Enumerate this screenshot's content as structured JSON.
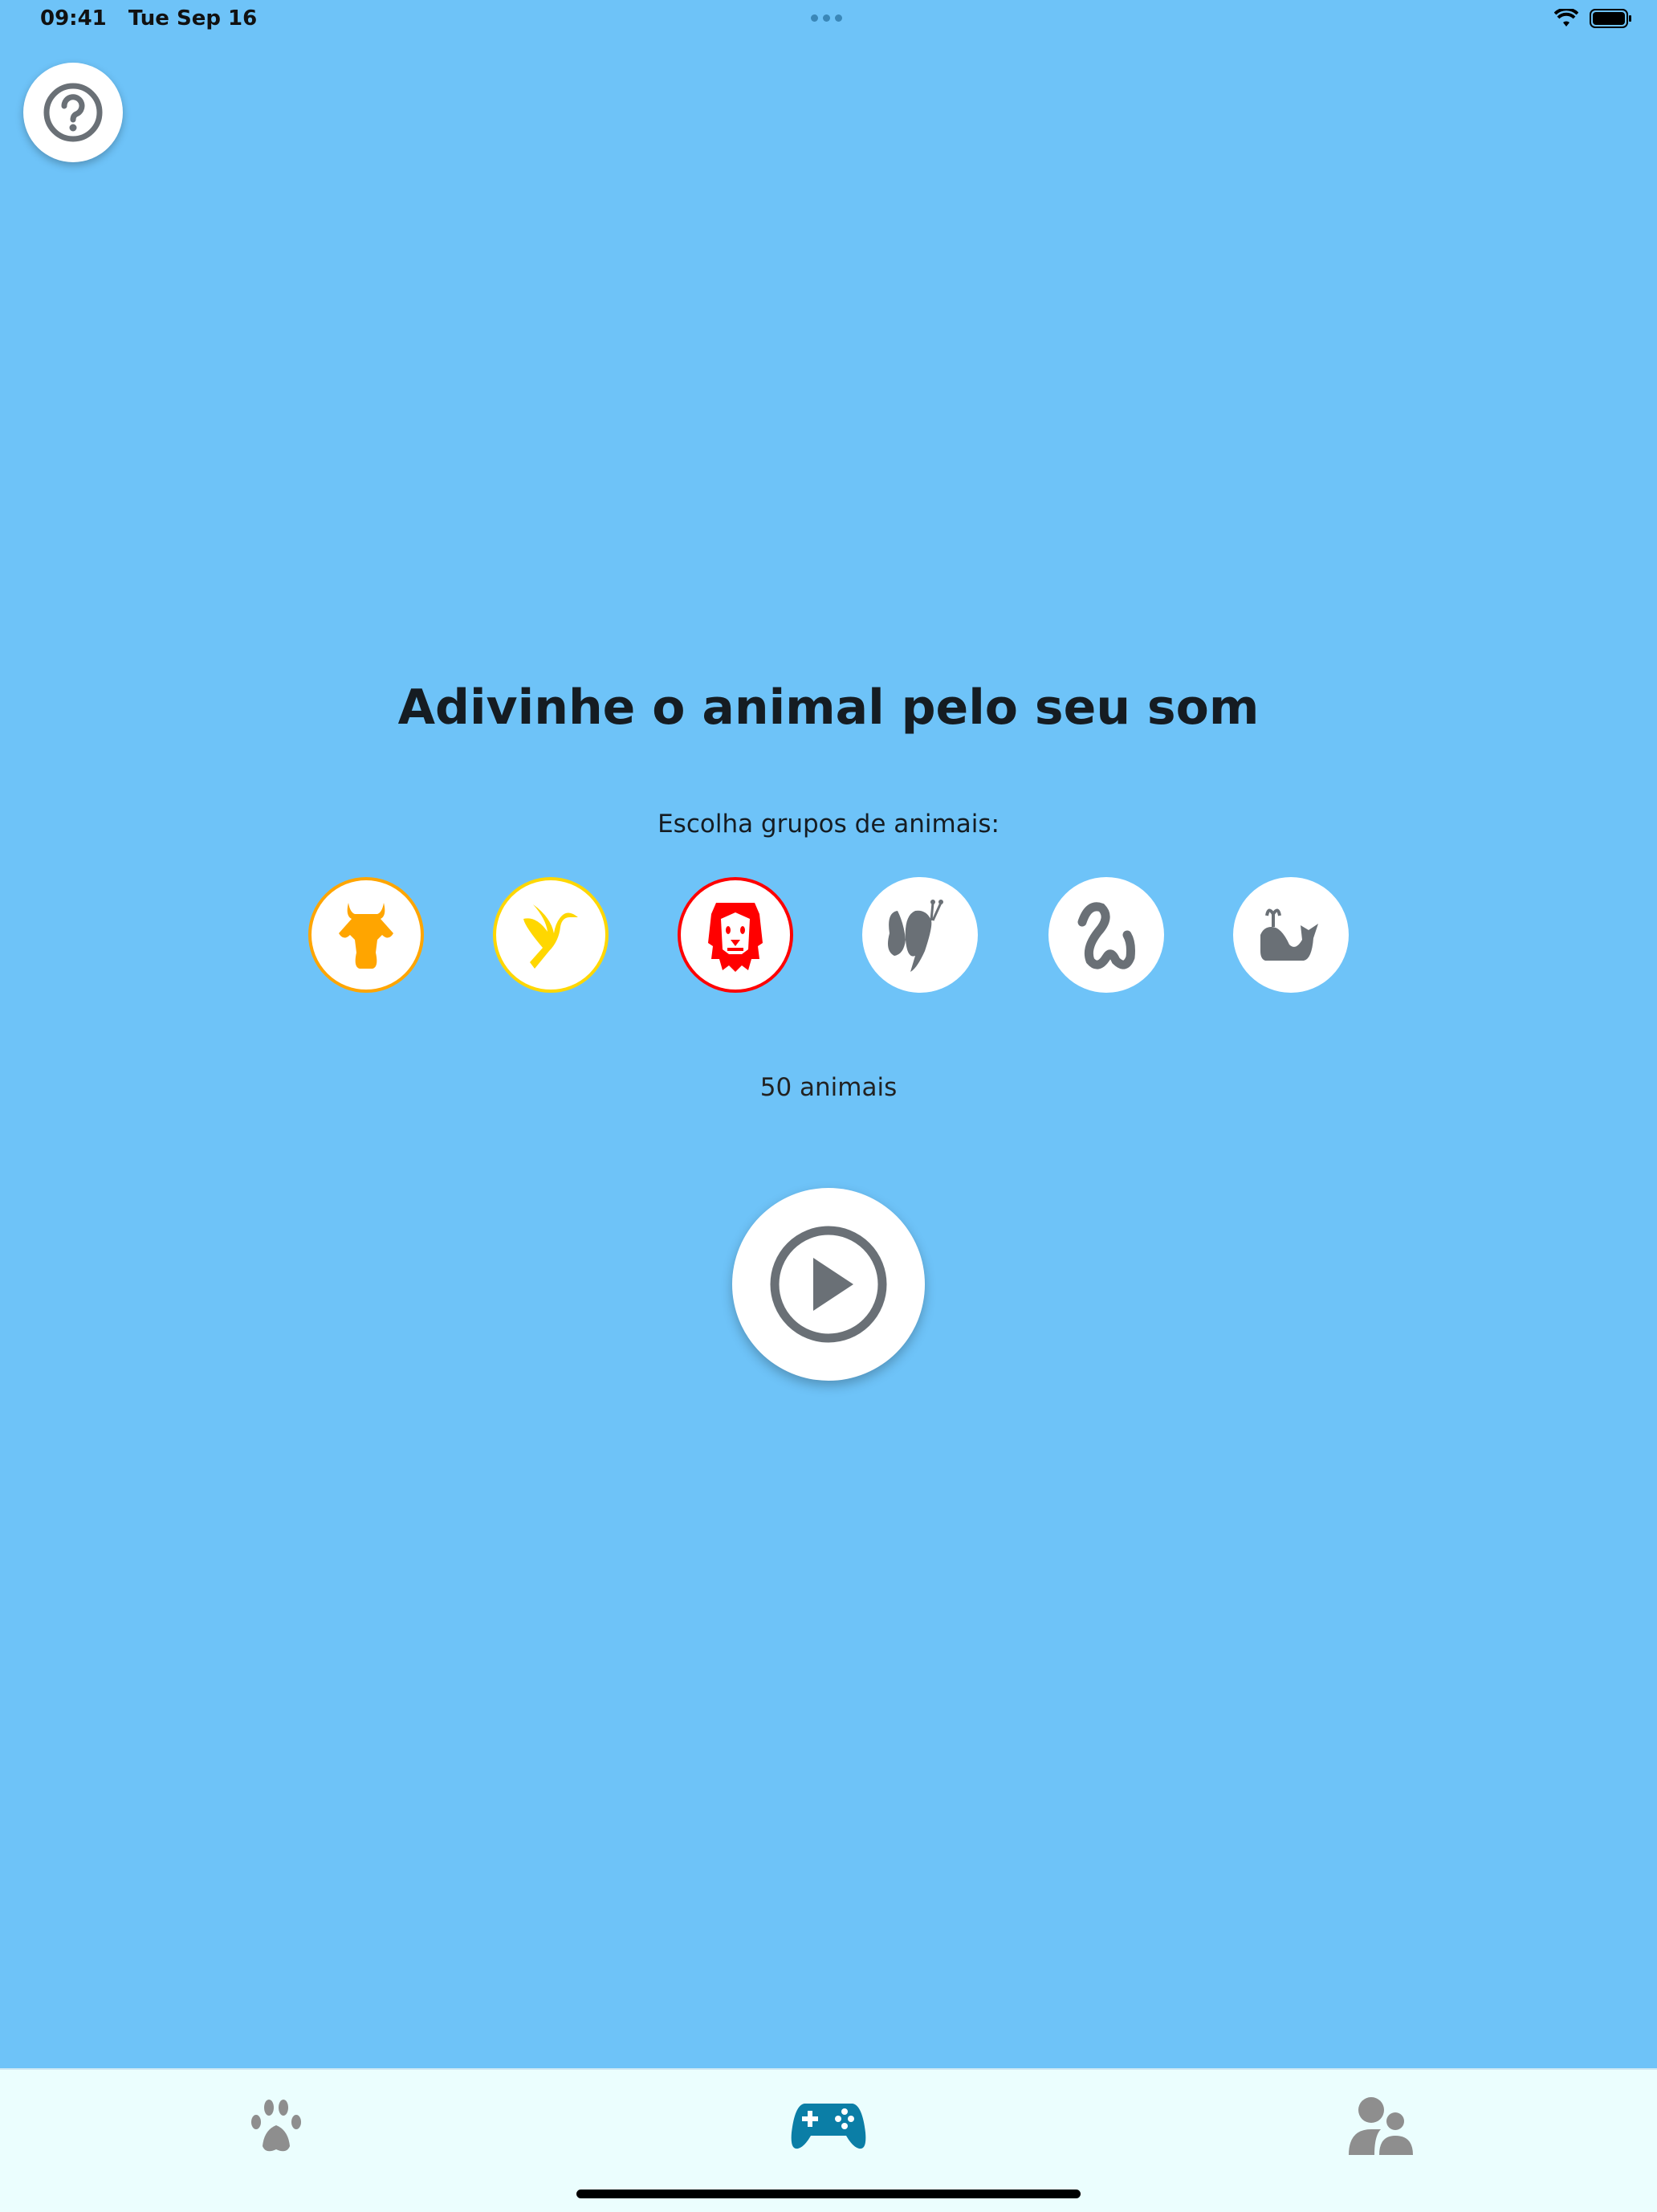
{
  "status_bar": {
    "time": "09:41",
    "date": "Tue Sep 16",
    "icons": [
      "wifi-icon",
      "battery-icon"
    ]
  },
  "help_button": {
    "icon": "question-circle-icon"
  },
  "main": {
    "title": "Adivinhe o animal pelo seu som",
    "subtitle": "Escolha grupos de animais:",
    "groups": [
      {
        "icon": "cow-icon",
        "selected": true,
        "color": "#FFA500"
      },
      {
        "icon": "bird-icon",
        "selected": true,
        "color": "#FFD700"
      },
      {
        "icon": "lion-icon",
        "selected": true,
        "color": "#FF0000"
      },
      {
        "icon": "butterfly-icon",
        "selected": false,
        "color": "#6a7076"
      },
      {
        "icon": "snake-icon",
        "selected": false,
        "color": "#6a7076"
      },
      {
        "icon": "whale-icon",
        "selected": false,
        "color": "#6a7076"
      }
    ],
    "count": "50 animais",
    "play_icon": "play-circle-icon"
  },
  "tabbar": {
    "tabs": [
      {
        "icon": "paw-icon",
        "active": false
      },
      {
        "icon": "gamepad-icon",
        "active": true
      },
      {
        "icon": "users-icon",
        "active": false
      }
    ],
    "active_color": "#0b7ea6",
    "inactive_color": "#8e8e8e"
  }
}
